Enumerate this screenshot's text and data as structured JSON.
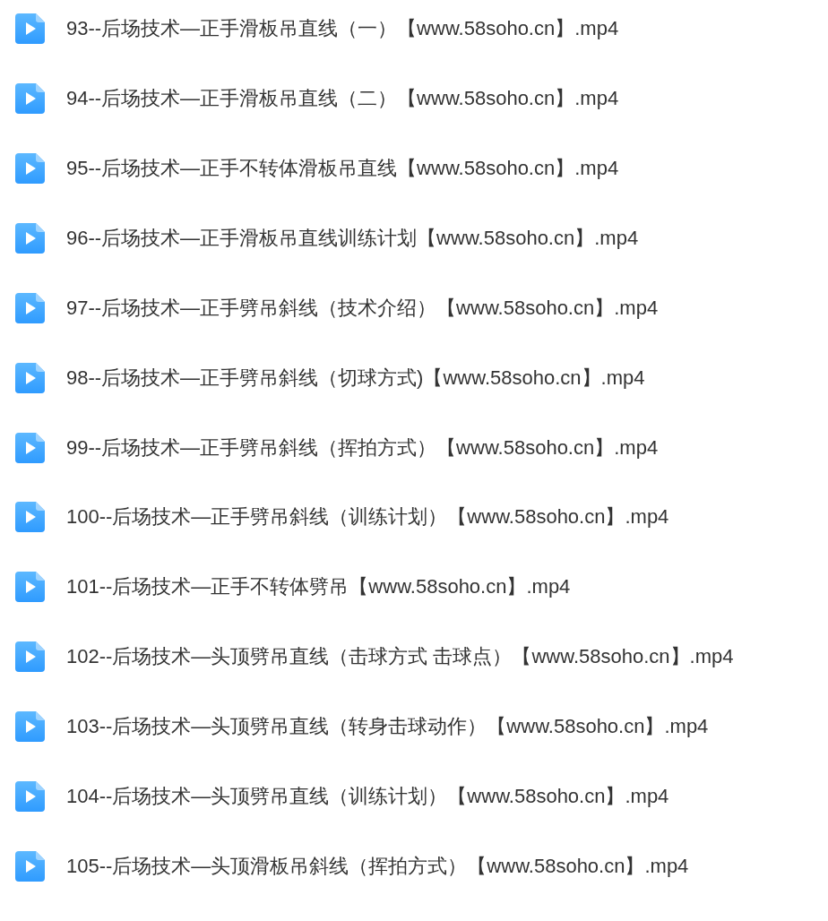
{
  "files": [
    {
      "name": "93--后场技术—正手滑板吊直线（一）【www.58soho.cn】.mp4"
    },
    {
      "name": "94--后场技术—正手滑板吊直线（二）【www.58soho.cn】.mp4"
    },
    {
      "name": "95--后场技术—正手不转体滑板吊直线【www.58soho.cn】.mp4"
    },
    {
      "name": "96--后场技术—正手滑板吊直线训练计划【www.58soho.cn】.mp4"
    },
    {
      "name": "97--后场技术—正手劈吊斜线（技术介绍）【www.58soho.cn】.mp4"
    },
    {
      "name": "98--后场技术—正手劈吊斜线（切球方式)【www.58soho.cn】.mp4"
    },
    {
      "name": "99--后场技术—正手劈吊斜线（挥拍方式）【www.58soho.cn】.mp4"
    },
    {
      "name": "100--后场技术—正手劈吊斜线（训练计划）【www.58soho.cn】.mp4"
    },
    {
      "name": "101--后场技术—正手不转体劈吊【www.58soho.cn】.mp4"
    },
    {
      "name": "102--后场技术—头顶劈吊直线（击球方式 击球点）【www.58soho.cn】.mp4"
    },
    {
      "name": "103--后场技术—头顶劈吊直线（转身击球动作）【www.58soho.cn】.mp4"
    },
    {
      "name": "104--后场技术—头顶劈吊直线（训练计划）【www.58soho.cn】.mp4"
    },
    {
      "name": "105--后场技术—头顶滑板吊斜线（挥拍方式）【www.58soho.cn】.mp4"
    }
  ]
}
